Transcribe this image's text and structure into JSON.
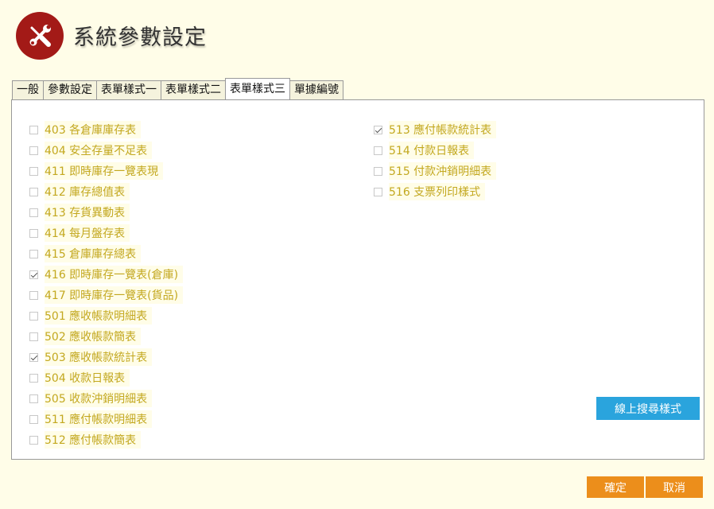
{
  "header": {
    "title": "系統參數設定",
    "logo_icon": "tools-icon",
    "logo_color": "#a31a17"
  },
  "tabs": [
    {
      "label": "一般",
      "active": false
    },
    {
      "label": "參數設定",
      "active": false
    },
    {
      "label": "表單樣式一",
      "active": false
    },
    {
      "label": "表單樣式二",
      "active": false
    },
    {
      "label": "表單樣式三",
      "active": true
    },
    {
      "label": "單據編號",
      "active": false
    }
  ],
  "left_column": [
    {
      "label": "403 各倉庫庫存表",
      "checked": false
    },
    {
      "label": "404 安全存量不足表",
      "checked": false
    },
    {
      "label": "411 即時庫存一覽表現",
      "checked": false
    },
    {
      "label": "412 庫存總值表",
      "checked": false
    },
    {
      "label": "413 存貨異動表",
      "checked": false
    },
    {
      "label": "414 每月盤存表",
      "checked": false
    },
    {
      "label": "415 倉庫庫存總表",
      "checked": false
    },
    {
      "label": "416 即時庫存一覽表(倉庫)",
      "checked": true
    },
    {
      "label": "417 即時庫存一覽表(貨品)",
      "checked": false
    },
    {
      "label": "501 應收帳款明細表",
      "checked": false
    },
    {
      "label": "502 應收帳款簡表",
      "checked": false
    },
    {
      "label": "503 應收帳款統計表",
      "checked": true
    },
    {
      "label": "504 收款日報表",
      "checked": false
    },
    {
      "label": "505 收款沖銷明細表",
      "checked": false
    },
    {
      "label": "511 應付帳款明細表",
      "checked": false
    },
    {
      "label": "512 應付帳款簡表",
      "checked": false
    }
  ],
  "right_column": [
    {
      "label": "513 應付帳款統計表",
      "checked": true
    },
    {
      "label": "514 付款日報表",
      "checked": false
    },
    {
      "label": "515 付款沖銷明細表",
      "checked": false
    },
    {
      "label": "516 支票列印樣式",
      "checked": false
    }
  ],
  "buttons": {
    "search_online": "線上搜尋樣式",
    "confirm": "確定",
    "cancel": "取消"
  },
  "colors": {
    "background": "#fffde8",
    "label_text": "#c3a81f",
    "search_button": "#2aa4dd",
    "action_button": "#ec8e1b"
  }
}
